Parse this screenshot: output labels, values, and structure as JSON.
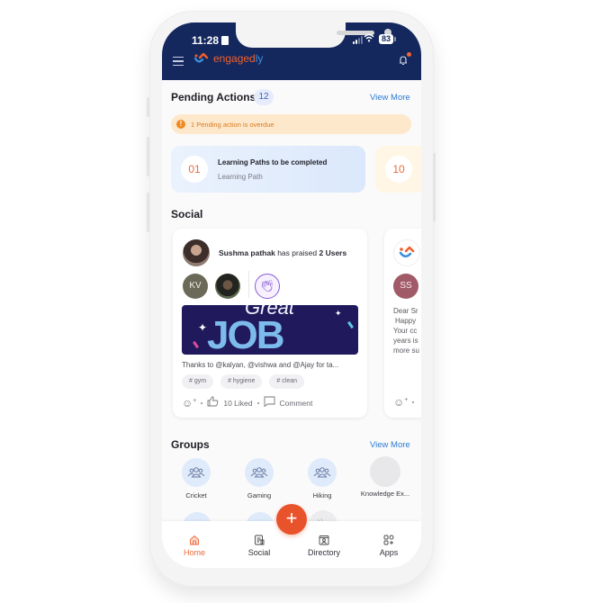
{
  "status_bar": {
    "time": "11:28",
    "battery": "83"
  },
  "header": {
    "brand_main": "engaged",
    "brand_accent": "ly",
    "notification_dot": true
  },
  "pending_actions": {
    "title": "Pending Actions",
    "count": "12",
    "view_more": "View More",
    "overdue_icon": "!",
    "overdue_text": "1 Pending action is overdue",
    "cards": [
      {
        "number": "01",
        "title": "Learning Paths to be completed",
        "subtitle": "Learning Path"
      },
      {
        "number": "10",
        "title": "",
        "subtitle": ""
      }
    ]
  },
  "social": {
    "title": "Social",
    "posts": [
      {
        "author": "Sushma pathak",
        "action": " has praised ",
        "target": "2 Users",
        "recipients": [
          {
            "initials": "KV"
          },
          {
            "initials": ""
          }
        ],
        "praise_icon": "clapping-hands",
        "banner_word": "JOB",
        "banner_top": "Great",
        "text": "Thanks to @kalyan, @vishwa and @Ajay for ta...",
        "tags": [
          "# gym",
          "# hygiene",
          "# clean"
        ],
        "likes": "10 Liked",
        "comment": "Comment"
      },
      {
        "recipient_initials": "SS",
        "text_lines": [
          "Dear Sr",
          "Happy",
          "Your cc",
          "years is",
          "more su"
        ]
      }
    ]
  },
  "groups": {
    "title": "Groups",
    "view_more": "View More",
    "items": [
      {
        "label": "Cricket"
      },
      {
        "label": "Gaming"
      },
      {
        "label": "Hiking"
      },
      {
        "label": "Knowledge Ex..."
      }
    ]
  },
  "fab": {
    "label": "+"
  },
  "bottom_nav": {
    "items": [
      {
        "label": "Home",
        "active": true
      },
      {
        "label": "Social"
      },
      {
        "label": "Directory"
      },
      {
        "label": "Apps"
      }
    ]
  },
  "colors": {
    "header_bg": "#14285e",
    "accent_orange": "#e8532c",
    "link_blue": "#2c7bd6",
    "overdue_bg": "#fde8cc"
  }
}
